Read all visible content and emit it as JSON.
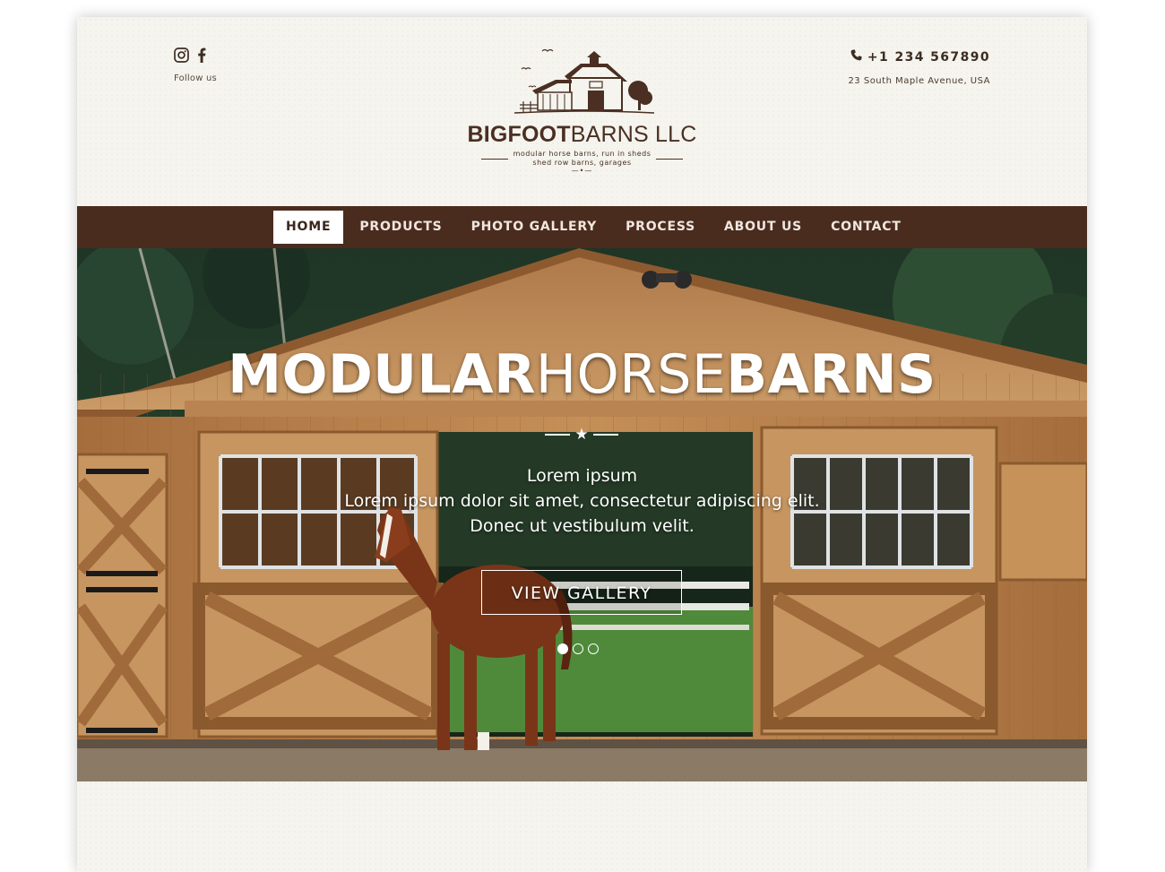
{
  "header": {
    "social": {
      "icons": [
        "instagram-icon",
        "facebook-icon"
      ],
      "follow_label": "Follow us"
    },
    "logo": {
      "name_bold": "BIGFOOT",
      "name_light": "BARNS LLC",
      "tagline_line1": "modular horse barns, run in sheds",
      "tagline_line2": "shed row barns, garages",
      "bottom_mark": "—•—"
    },
    "contact": {
      "phone_icon": "phone-icon",
      "phone": "+1 234 567890",
      "address": "23 South Maple Avenue, USA"
    }
  },
  "nav": {
    "items": [
      {
        "label": "HOME",
        "active": true
      },
      {
        "label": "PRODUCTS"
      },
      {
        "label": "PHOTO GALLERY"
      },
      {
        "label": "PROCESS"
      },
      {
        "label": "ABOUT US"
      },
      {
        "label": "CONTACT"
      }
    ]
  },
  "hero": {
    "title_part1": "MODULAR",
    "title_part2": "HORSE",
    "title_part3": "BARNS",
    "divider_icon": "star-icon",
    "subtitle_line1": "Lorem ipsum",
    "subtitle_line2": "Lorem ipsum dolor sit amet, consectetur adipiscing elit.",
    "subtitle_line3": "Donec ut vestibulum velit.",
    "button_label": "VIEW GALLERY",
    "slides_total": 3,
    "slide_active": 1
  },
  "colors": {
    "brand_brown": "#4a2c1f",
    "page_bg": "#f5f4ee",
    "nav_text": "#f1e7df"
  }
}
